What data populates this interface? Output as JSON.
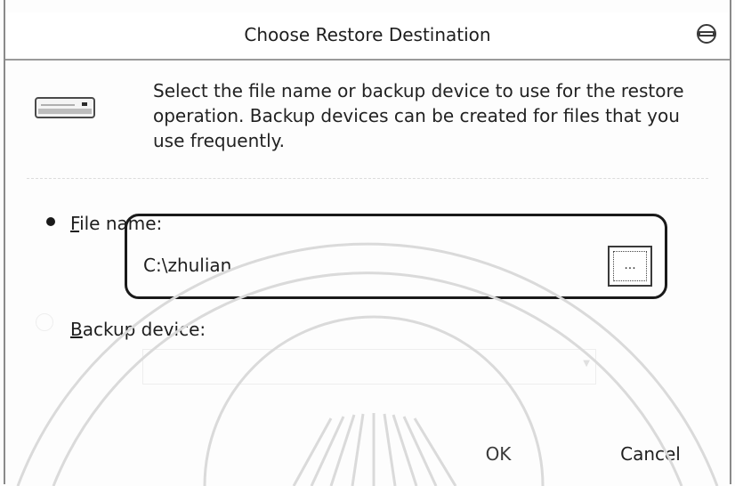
{
  "dialog": {
    "title": "Choose Restore Destination",
    "description": "Select the file name or backup device to use for the restore operation.  Backup devices can be created for files that you use frequently.",
    "header_icon": "drive-icon",
    "help_icon": "help-icon"
  },
  "file_name": {
    "mnemonic": "F",
    "label_rest": "ile name:",
    "selected": true,
    "value": "C:\\zhulian",
    "browse_label": "..."
  },
  "backup_device": {
    "mnemonic": "B",
    "label_rest": "ackup device:",
    "selected": false
  },
  "buttons": {
    "ok_label": "OK",
    "cancel_label": "Cancel"
  },
  "colors": {
    "callout_border": "#1a1a1a",
    "text": "#1e1e1e",
    "watermark": "#d8d8d8"
  }
}
